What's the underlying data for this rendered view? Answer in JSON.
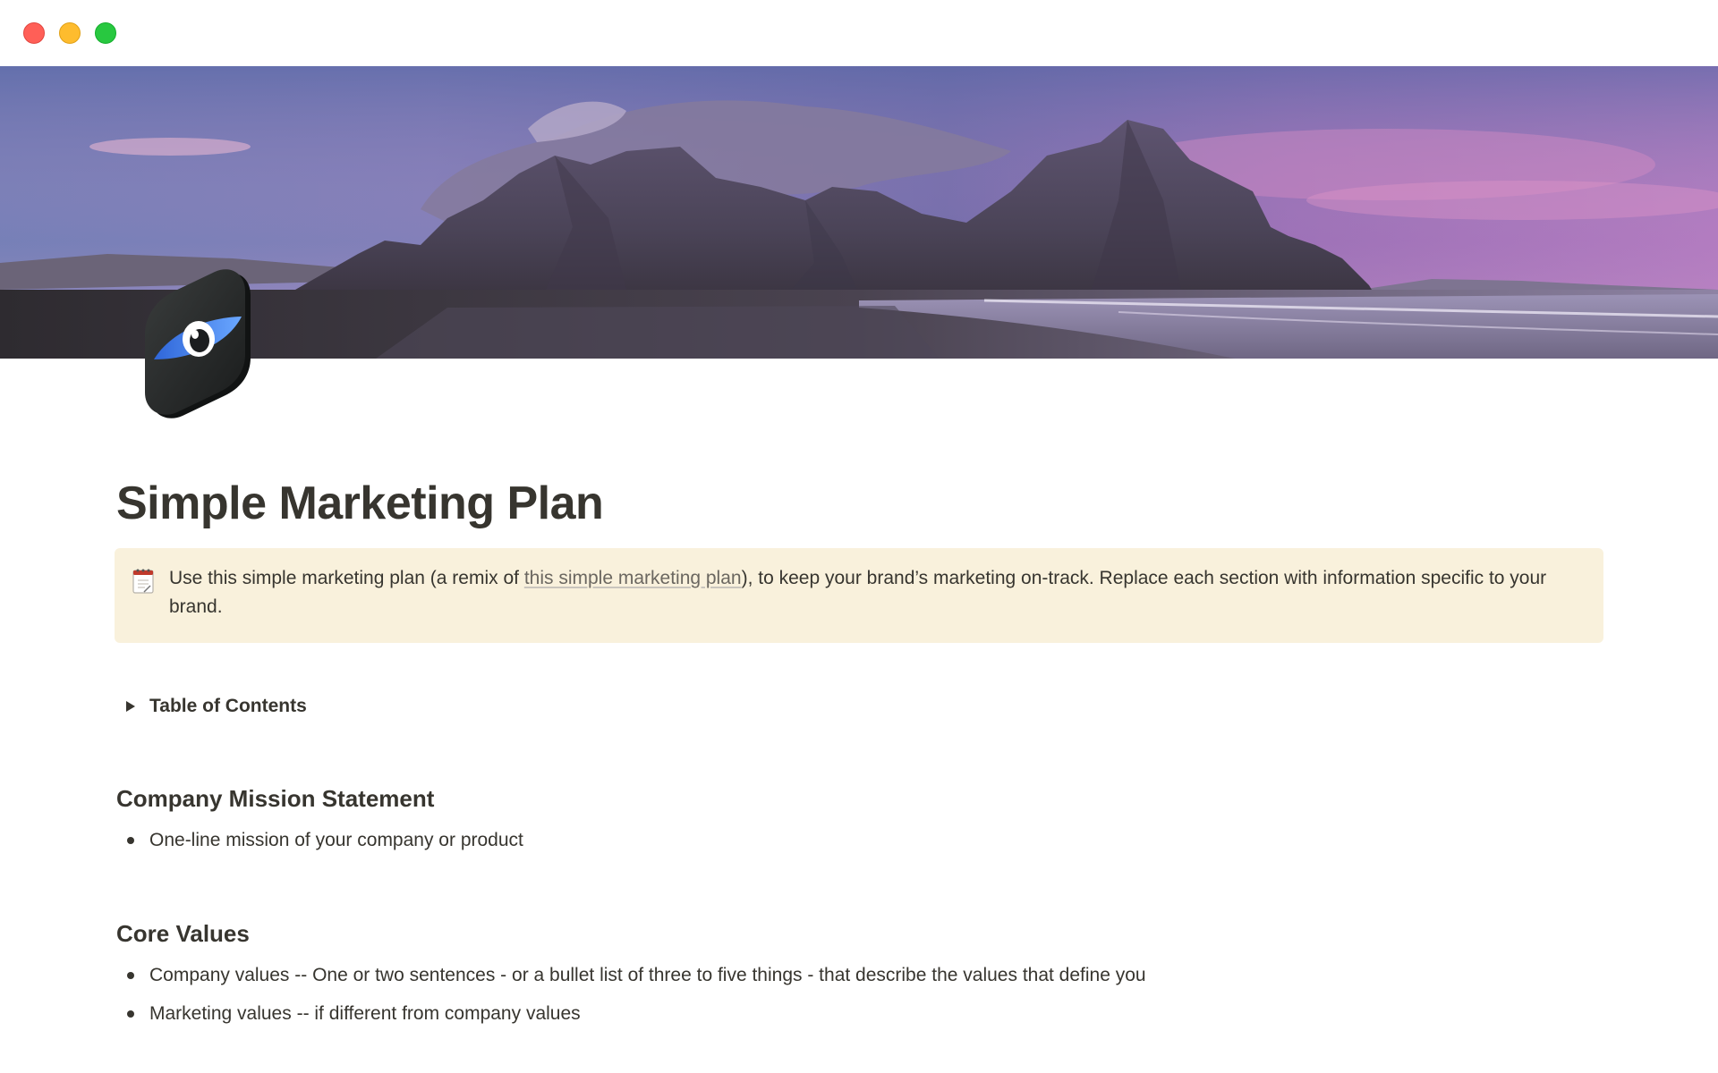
{
  "window": {
    "controls": {
      "close": "close-button",
      "minimize": "minimize-button",
      "maximize": "maximize-button"
    }
  },
  "cover": {
    "icon": "mountain-landscape-image"
  },
  "page": {
    "icon": "eye-app-icon",
    "title": "Simple Marketing Plan",
    "callout": {
      "icon": "notepad-icon",
      "text_before": "Use this simple marketing plan (a remix of ",
      "link_text": "this simple marketing plan",
      "text_after": "), to keep your brand’s marketing on-track. Replace each section with information specific to your brand."
    },
    "toc_toggle": {
      "icon": "triangle-right-icon",
      "label": "Table of Contents"
    },
    "sections": [
      {
        "heading": "Company Mission Statement",
        "bullets": [
          "One-line mission of your company or product"
        ]
      },
      {
        "heading": "Core Values",
        "bullets": [
          "Company values -- One or two sentences - or a bullet list of three to five things - that describe the values that define you",
          "Marketing values -- if different from company values"
        ]
      }
    ]
  },
  "colors": {
    "text": "#37352f",
    "callout_bg": "#f9f1dc",
    "close": "#ff5f57",
    "minimize": "#febc2e",
    "maximize": "#28c840"
  }
}
